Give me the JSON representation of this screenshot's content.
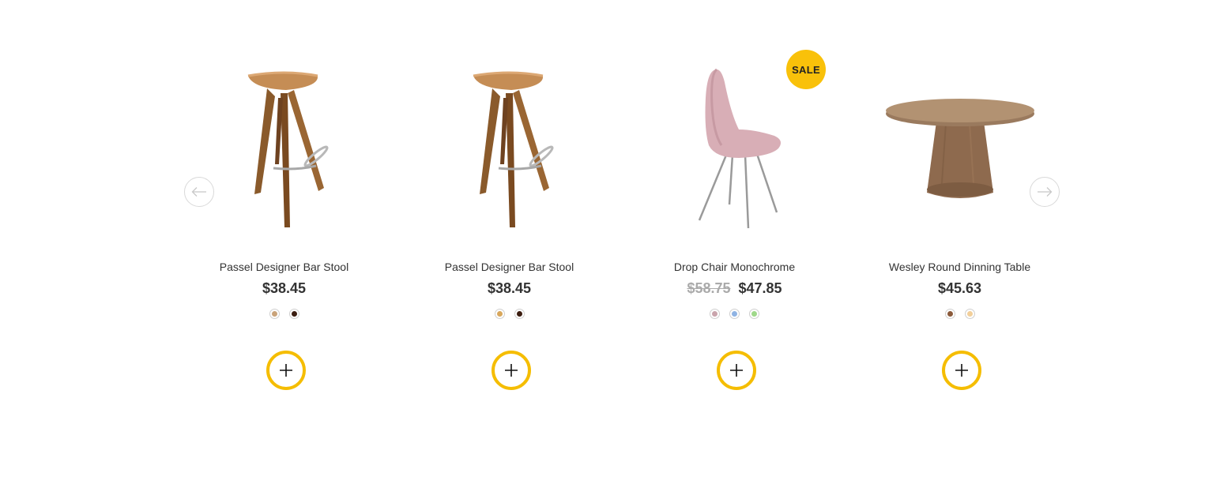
{
  "carousel": {
    "prev_icon": "arrow-left-icon",
    "next_icon": "arrow-right-icon"
  },
  "colors": {
    "accent": "#f5bd00",
    "sale_badge": "#f9c10a",
    "text": "#333333",
    "old_price": "#aaaaaa"
  },
  "products": [
    {
      "title": "Passel Designer Bar Stool",
      "price": "$38.45",
      "image": "bar-stool",
      "swatches": [
        "#c9a37a",
        "#3b1d10"
      ],
      "add_icon": "plus-icon"
    },
    {
      "title": "Passel Designer Bar Stool",
      "price": "$38.45",
      "image": "bar-stool",
      "swatches": [
        "#d8a75c",
        "#3b1d10"
      ],
      "add_icon": "plus-icon"
    },
    {
      "title": "Drop Chair Monochrome",
      "old_price": "$58.75",
      "price": "$47.85",
      "badge": "SALE",
      "image": "drop-chair",
      "swatches": [
        "#c9a4ac",
        "#8fb3e3",
        "#9fd88a"
      ],
      "add_icon": "plus-icon"
    },
    {
      "title": "Wesley Round Dinning Table",
      "price": "$45.63",
      "image": "round-table",
      "swatches": [
        "#8a5a3a",
        "#f2cf9a"
      ],
      "add_icon": "plus-icon"
    }
  ]
}
